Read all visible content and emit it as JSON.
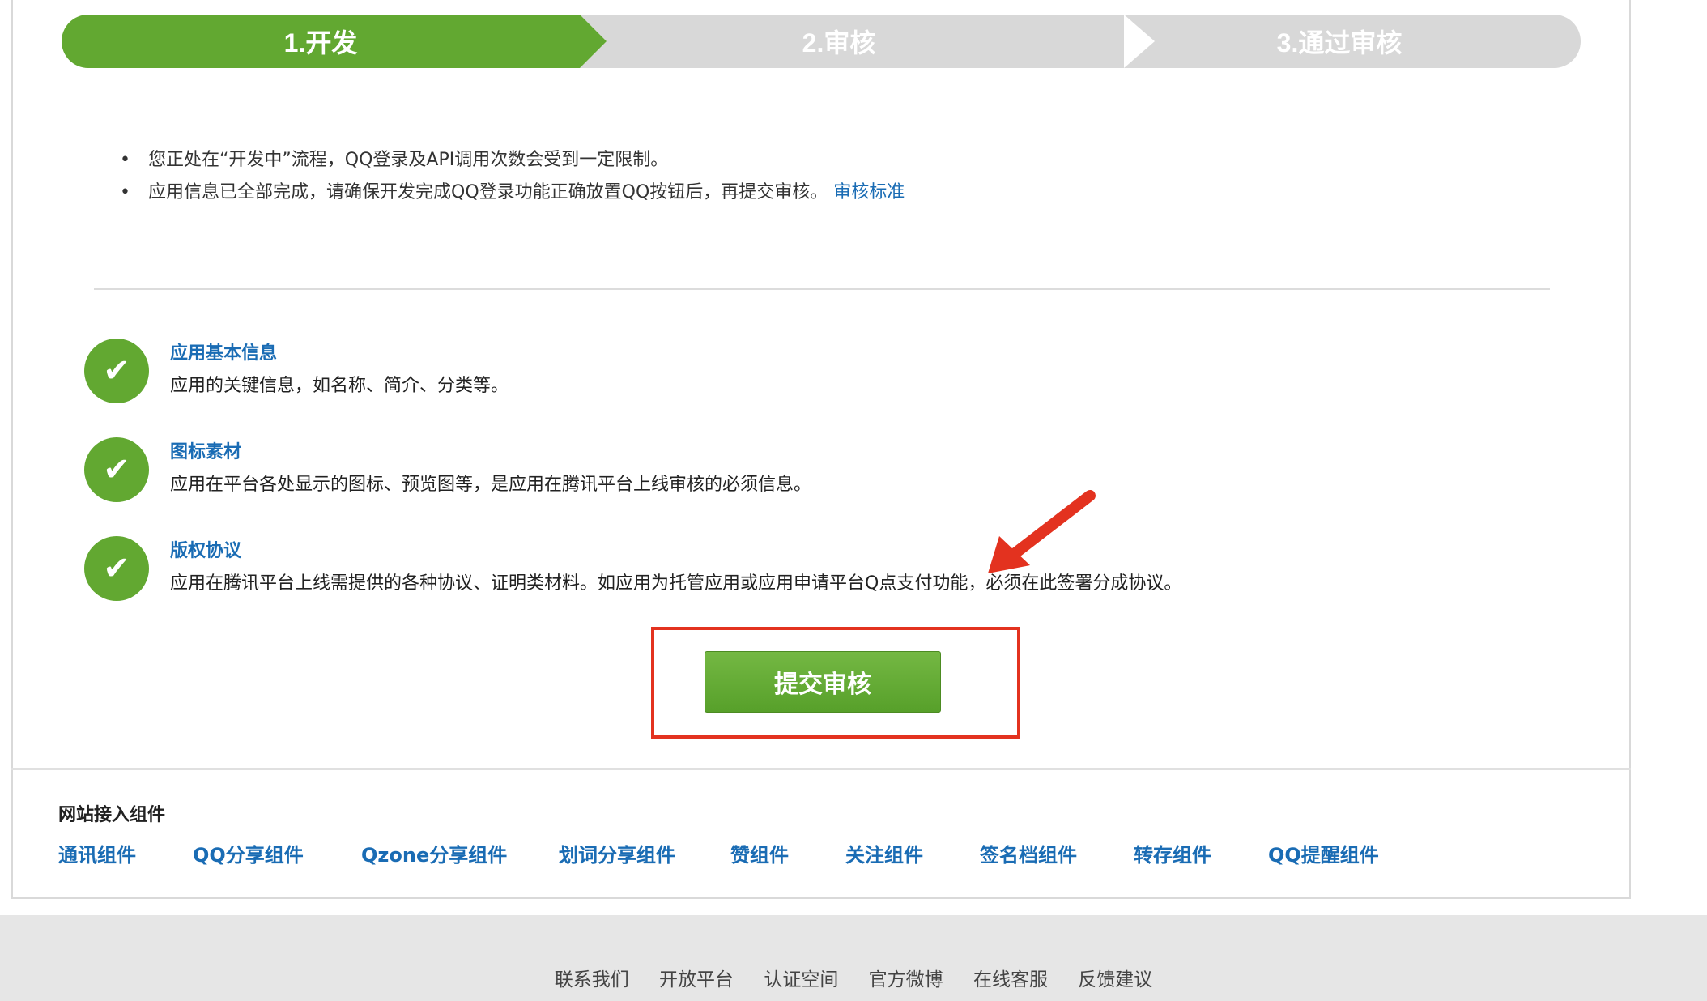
{
  "steps": [
    {
      "label": "1.开发",
      "state": "active"
    },
    {
      "label": "2.审核",
      "state": "pending"
    },
    {
      "label": "3.通过审核",
      "state": "pending"
    }
  ],
  "notices": [
    {
      "text": "您正处在“开发中”流程，QQ登录及API调用次数会受到一定限制。"
    },
    {
      "text": "应用信息已全部完成，请确保开发完成QQ登录功能正确放置QQ按钮后，再提交审核。",
      "link": "审核标准"
    }
  ],
  "tasks": [
    {
      "title": "应用基本信息",
      "desc": "应用的关键信息，如名称、简介、分类等。",
      "status": "done"
    },
    {
      "title": "图标素材",
      "desc": "应用在平台各处显示的图标、预览图等，是应用在腾讯平台上线审核的必须信息。",
      "status": "done"
    },
    {
      "title": "版权协议",
      "desc": "应用在腾讯平台上线需提供的各种协议、证明类材料。如应用为托管应用或应用申请平台Q点支付功能，必须在此签署分成协议。",
      "status": "done"
    }
  ],
  "submit_button": "提交审核",
  "components": {
    "title": "网站接入组件",
    "items": [
      "通讯组件",
      "QQ分享组件",
      "Qzone分享组件",
      "划词分享组件",
      "赞组件",
      "关注组件",
      "签名档组件",
      "转存组件",
      "QQ提醒组件"
    ]
  },
  "footer": {
    "links": [
      "联系我们",
      "开放平台",
      "认证空间",
      "官方微博",
      "在线客服",
      "反馈建议"
    ]
  },
  "colors": {
    "active_step": "#62a831",
    "inactive_step": "#d8d8d8",
    "link": "#1a6cb4",
    "highlight": "#e3321f"
  },
  "icons": {
    "check": "check-icon",
    "arrow": "annotation-arrow-icon"
  }
}
